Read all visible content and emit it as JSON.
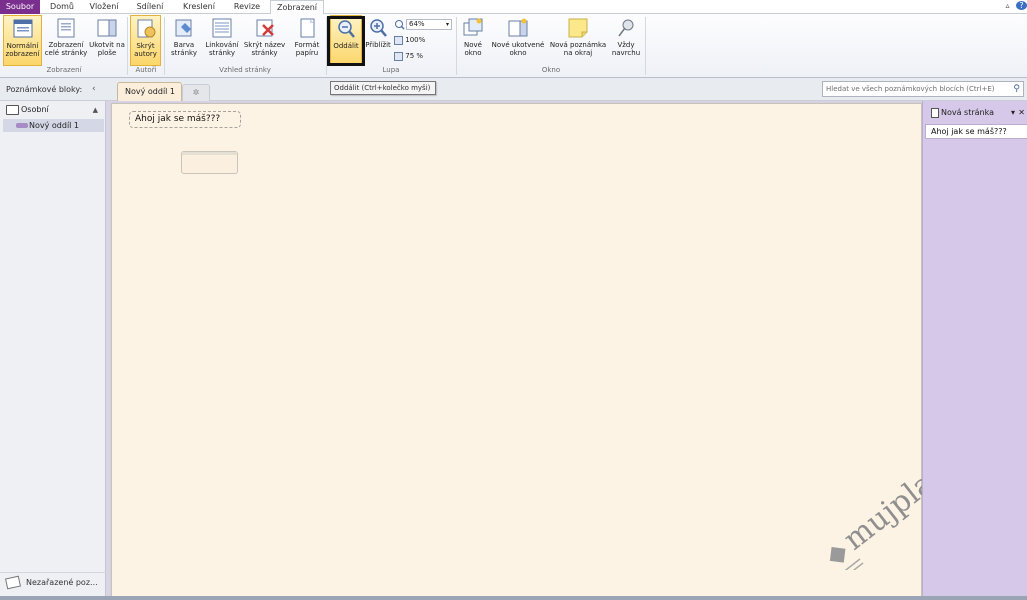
{
  "ribbon_tabs": {
    "file": "Soubor",
    "home": "Domů",
    "insert": "Vložení",
    "share": "Sdílení",
    "draw": "Kreslení",
    "review": "Revize",
    "view": "Zobrazení"
  },
  "ribbon": {
    "views": {
      "normal": "Normální zobrazení",
      "fullpage": "Zobrazení celé stránky",
      "dock": "Ukotvit na ploše",
      "group": "Zobrazení"
    },
    "authors": {
      "hide_authors": "Skrýt autory",
      "group": "Autoři"
    },
    "page_setup": {
      "page_color": "Barva stránky",
      "rule_lines": "Linkování stránky",
      "hide_title": "Skrýt název stránky",
      "paper_size": "Formát papíru",
      "group": "Vzhled stránky"
    },
    "zoom": {
      "zoom_out": "Oddálit",
      "zoom_in": "Přiblížit",
      "zoom_value": "64%",
      "zoom_100": "100%",
      "zoom_75": "75 %",
      "group": "Lupa"
    },
    "window": {
      "new_window": "Nové okno",
      "new_docked": "Nové ukotvené okno",
      "side_note": "Nová poznámka na okraj",
      "always_top": "Vždy navrchu",
      "group": "Okno"
    }
  },
  "tooltip": "Oddálit (Ctrl+kolečko myši)",
  "nav": {
    "notebooks_label": "Poznámkové bloky:",
    "section_tab": "Nový oddíl 1",
    "search_placeholder": "Hledat ve všech poznámkových blocích (Ctrl+E)"
  },
  "left_pane": {
    "notebook": "Osobní",
    "section": "Nový oddíl 1",
    "unfiled": "Nezařazené poz..."
  },
  "page": {
    "title": "Ahoj jak se máš???"
  },
  "right_pane": {
    "new_page": "Nová stránka",
    "pages": [
      "Ahoj jak se máš???"
    ]
  },
  "watermark": "mujplan.cz",
  "colors": {
    "file_tab": "#7a2e8e",
    "page_bg": "#fdf3e4",
    "right_pane_bg": "#d6c8e8",
    "highlight": "#fbd66a"
  }
}
